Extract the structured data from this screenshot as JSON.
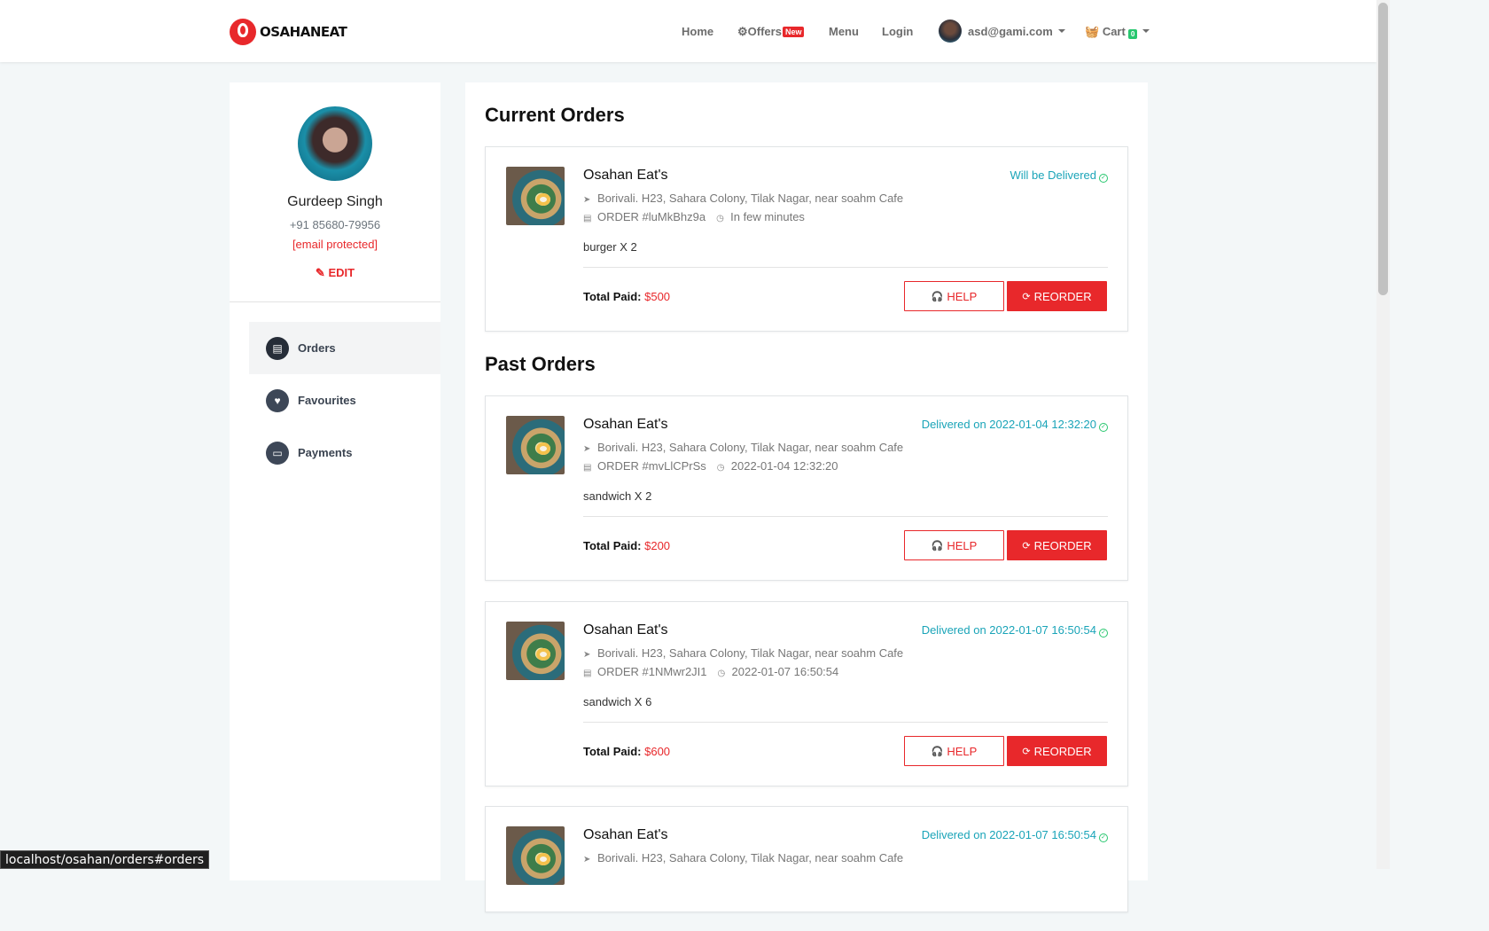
{
  "navbar": {
    "brand": "OSAHANEAT",
    "links": {
      "home": "Home",
      "offers": "Offers",
      "offers_badge": "New",
      "menu": "Menu",
      "login": "Login",
      "account": "asd@gami.com",
      "cart": "Cart",
      "cart_count": "0"
    }
  },
  "profile": {
    "name": "Gurdeep Singh",
    "phone": "+91 85680-79956",
    "email": "[email protected]",
    "edit_label": "EDIT"
  },
  "sidebar": {
    "items": [
      {
        "label": "Orders",
        "icon": "store-icon"
      },
      {
        "label": "Favourites",
        "icon": "heart-icon"
      },
      {
        "label": "Payments",
        "icon": "credit-card-icon"
      }
    ]
  },
  "main": {
    "current_title": "Current Orders",
    "past_title": "Past Orders",
    "total_label": "Total Paid:",
    "help_label": "HELP",
    "reorder_label": "REORDER",
    "current_orders": [
      {
        "restaurant": "Osahan Eat's",
        "status": "Will be Delivered",
        "address": "Borivali. H23, Sahara Colony, Tilak Nagar, near soahm Cafe",
        "order_id": "ORDER #luMkBhz9a",
        "time": "In few minutes",
        "items": "burger X 2",
        "total": "$500"
      }
    ],
    "past_orders": [
      {
        "restaurant": "Osahan Eat's",
        "status": "Delivered on 2022-01-04 12:32:20",
        "address": "Borivali. H23, Sahara Colony, Tilak Nagar, near soahm Cafe",
        "order_id": "ORDER #mvLlCPrSs",
        "time": "2022-01-04 12:32:20",
        "items": "sandwich X 2",
        "total": "$200"
      },
      {
        "restaurant": "Osahan Eat's",
        "status": "Delivered on 2022-01-07 16:50:54",
        "address": "Borivali. H23, Sahara Colony, Tilak Nagar, near soahm Cafe",
        "order_id": "ORDER #1NMwr2JI1",
        "time": "2022-01-07 16:50:54",
        "items": "sandwich X 6",
        "total": "$600"
      },
      {
        "restaurant": "Osahan Eat's",
        "status": "Delivered on 2022-01-07 16:50:54",
        "address": "Borivali. H23, Sahara Colony, Tilak Nagar, near soahm Cafe"
      }
    ]
  },
  "status_bar": "localhost/osahan/orders#orders"
}
